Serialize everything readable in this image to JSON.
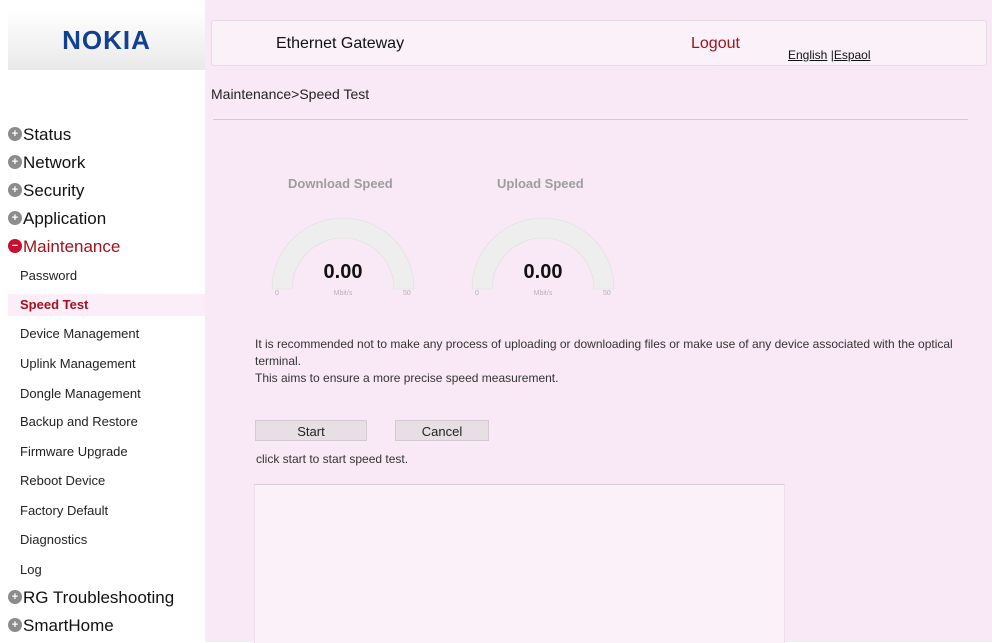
{
  "logo": "NOKIA",
  "header": {
    "title": "Ethernet Gateway",
    "logout": "Logout",
    "lang_english": "English",
    "lang_sep": " |",
    "lang_spanish": "Espaol"
  },
  "breadcrumb": "Maintenance>Speed Test",
  "menu": {
    "status": "Status",
    "network": "Network",
    "security": "Security",
    "application": "Application",
    "maintenance": "Maintenance",
    "rg_troubleshooting": "RG Troubleshooting",
    "smarthome": "SmartHome",
    "sub": {
      "password": "Password",
      "speed_test": "Speed Test",
      "device_management": "Device Management",
      "uplink_management": "Uplink Management",
      "dongle_management": "Dongle Management",
      "backup_restore": "Backup and Restore",
      "firmware_upgrade": "Firmware Upgrade",
      "reboot_device": "Reboot Device",
      "factory_default": "Factory Default",
      "diagnostics": "Diagnostics",
      "log": "Log"
    },
    "expand_glyph": "+",
    "collapse_glyph": "−"
  },
  "gauges": {
    "download": {
      "title": "Download Speed",
      "value": "0.00",
      "unit": "Mbit/s",
      "min": "0",
      "max": "50"
    },
    "upload": {
      "title": "Upload Speed",
      "value": "0.00",
      "unit": "Mbit/s",
      "min": "0",
      "max": "50"
    }
  },
  "note": {
    "line1": "It is recommended not to make any process of uploading or downloading files or make use of any device associated with the optical terminal.",
    "line2": "This aims to ensure a more precise speed measurement."
  },
  "buttons": {
    "start": "Start",
    "cancel": "Cancel"
  },
  "hint": "click start to start speed test.",
  "colors": {
    "brand": "#124191",
    "accent": "#a3111d",
    "background": "#f9e9f6"
  }
}
